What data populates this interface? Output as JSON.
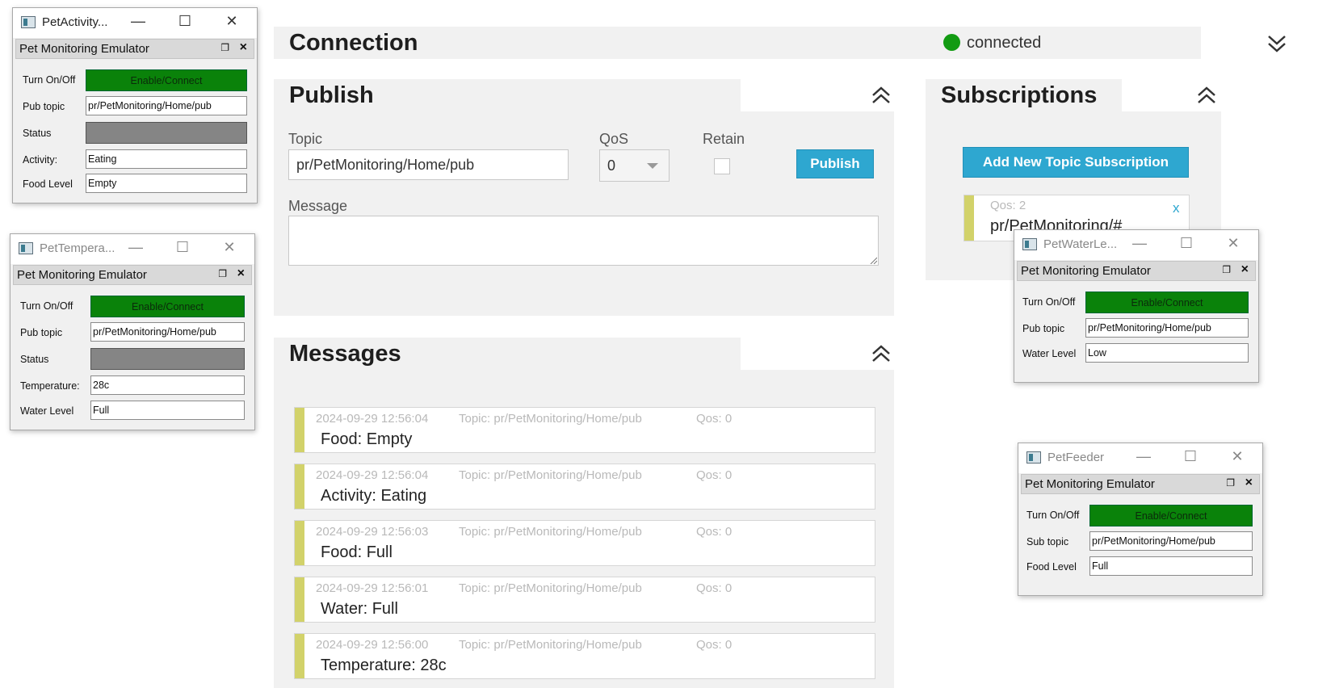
{
  "connection": {
    "title": "Connection",
    "status": "connected",
    "status_color": "#129b12",
    "toggle_icon": "double-chevron-down-icon"
  },
  "publish": {
    "title": "Publish",
    "topic_label": "Topic",
    "topic_value": "pr/PetMonitoring/Home/pub",
    "qos_label": "QoS",
    "qos_value": "0",
    "retain_label": "Retain",
    "publish_button": "Publish",
    "message_label": "Message",
    "message_value": ""
  },
  "subscriptions": {
    "title": "Subscriptions",
    "add_button": "Add New Topic Subscription",
    "items": [
      {
        "qos": "Qos: 2",
        "topic": "pr/PetMonitoring/#",
        "remove": "x"
      }
    ]
  },
  "messages": {
    "title": "Messages",
    "items": [
      {
        "time": "2024-09-29 12:56:04",
        "topic": "Topic: pr/PetMonitoring/Home/pub",
        "qos": "Qos: 0",
        "body": "Food: Empty"
      },
      {
        "time": "2024-09-29 12:56:04",
        "topic": "Topic: pr/PetMonitoring/Home/pub",
        "qos": "Qos: 0",
        "body": "Activity: Eating"
      },
      {
        "time": "2024-09-29 12:56:03",
        "topic": "Topic: pr/PetMonitoring/Home/pub",
        "qos": "Qos: 0",
        "body": "Food: Full"
      },
      {
        "time": "2024-09-29 12:56:01",
        "topic": "Topic: pr/PetMonitoring/Home/pub",
        "qos": "Qos: 0",
        "body": "Water: Full"
      },
      {
        "time": "2024-09-29 12:56:00",
        "topic": "Topic: pr/PetMonitoring/Home/pub",
        "qos": "Qos: 0",
        "body": "Temperature: 28c"
      }
    ]
  },
  "windows": {
    "activity": {
      "title": "PetActivity...",
      "dock_title": "Pet Monitoring Emulator",
      "turn_label": "Turn On/Off",
      "button": "Enable/Connect",
      "pub_label": "Pub topic",
      "pub_value": "pr/PetMonitoring/Home/pub",
      "status_label": "Status",
      "activity_label": "Activity:",
      "activity_value": "Eating",
      "food_label": "Food Level",
      "food_value": "Empty"
    },
    "temperature": {
      "title": "PetTempera...",
      "dock_title": "Pet Monitoring Emulator",
      "turn_label": "Turn On/Off",
      "button": "Enable/Connect",
      "pub_label": "Pub topic",
      "pub_value": "pr/PetMonitoring/Home/pub",
      "status_label": "Status",
      "temp_label": "Temperature:",
      "temp_value": "28c",
      "water_label": "Water Level",
      "water_value": "Full"
    },
    "water": {
      "title": "PetWaterLe...",
      "dock_title": "Pet Monitoring Emulator",
      "turn_label": "Turn On/Off",
      "button": "Enable/Connect",
      "pub_label": "Pub topic",
      "pub_value": "pr/PetMonitoring/Home/pub",
      "water_label": "Water Level",
      "water_value": "Low"
    },
    "feeder": {
      "title": "PetFeeder",
      "dock_title": "Pet Monitoring Emulator",
      "turn_label": "Turn On/Off",
      "button": "Enable/Connect",
      "sub_label": "Sub topic",
      "sub_value": "pr/PetMonitoring/Home/pub",
      "food_label": "Food Level",
      "food_value": "Full"
    }
  },
  "colors": {
    "accent": "#2ea7d0",
    "panel": "#f1f1f1",
    "message_bar": "#d2d26a",
    "enable_green": "#0a820a"
  }
}
